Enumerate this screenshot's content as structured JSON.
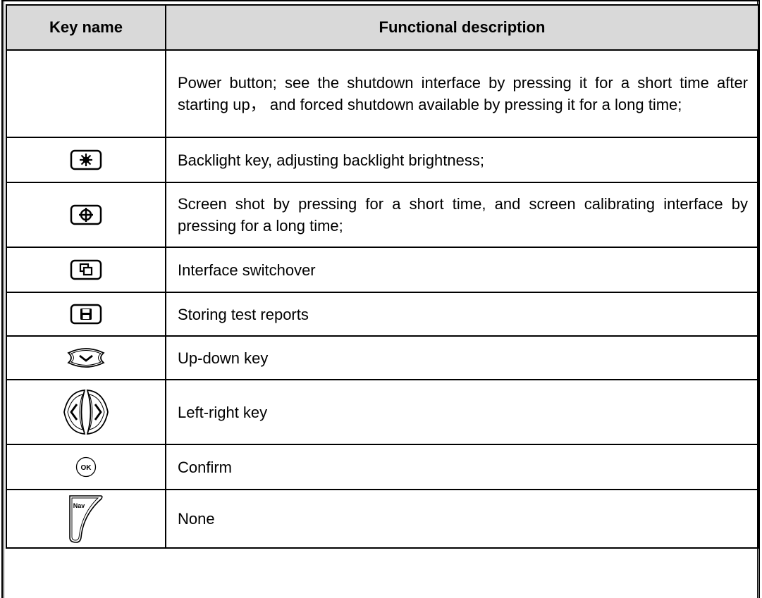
{
  "table": {
    "headers": {
      "key_name": "Key name",
      "description": "Functional description"
    },
    "rows": [
      {
        "icon": "power-key-icon-missing",
        "description": "Power button; see the shutdown interface by pressing it for a short time after starting up， and forced shutdown available by pressing it for a long time;"
      },
      {
        "icon": "backlight-key-icon",
        "description": "Backlight key, adjusting backlight brightness;"
      },
      {
        "icon": "screenshot-key-icon",
        "description": "Screen shot by pressing for a short time, and screen calibrating interface by pressing for a long time;"
      },
      {
        "icon": "switch-interface-key-icon",
        "description": "Interface switchover"
      },
      {
        "icon": "save-key-icon",
        "description": "Storing test reports"
      },
      {
        "icon": "up-down-key-icon",
        "description": "Up-down key"
      },
      {
        "icon": "left-right-key-icon",
        "description": "Left-right key"
      },
      {
        "icon": "ok-key-icon",
        "description": "Confirm",
        "icon_label": "OK"
      },
      {
        "icon": "nav-key-icon",
        "description": "None",
        "icon_label": "Nav"
      }
    ]
  }
}
